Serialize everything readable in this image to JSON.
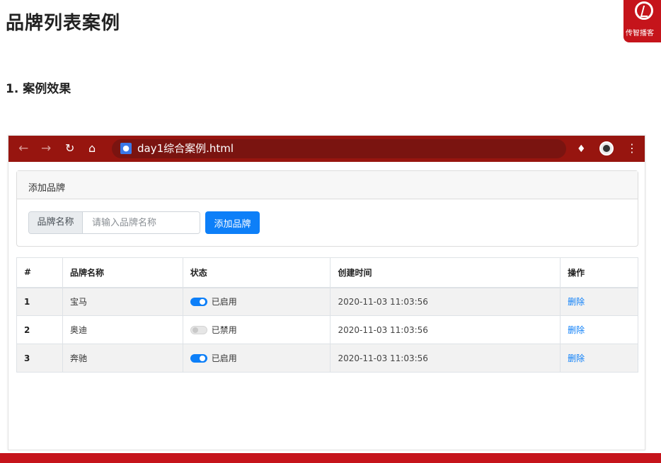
{
  "page": {
    "title": "品牌列表案例",
    "section_title": "1. 案例效果",
    "logo_text": "传智播客"
  },
  "browser": {
    "nav": {
      "back_icon": "arrow-left-icon",
      "forward_icon": "arrow-right-icon",
      "reload_icon": "reload-icon",
      "home_icon": "home-icon"
    },
    "tab_url": "day1综合案例.html",
    "toolbar_icons": [
      "extension-icon",
      "avatar",
      "more-vert-icon"
    ]
  },
  "form": {
    "card_title": "添加品牌",
    "input_label": "品牌名称",
    "input_placeholder": "请输入品牌名称",
    "input_value": "",
    "add_button": "添加品牌"
  },
  "table": {
    "headers": [
      "#",
      "品牌名称",
      "状态",
      "创建时间",
      "操作"
    ],
    "rows": [
      {
        "id": "1",
        "name": "宝马",
        "enabled": true,
        "status": "已启用",
        "time": "2020-11-03 11:03:56",
        "action": "删除"
      },
      {
        "id": "2",
        "name": "奥迪",
        "enabled": false,
        "status": "已禁用",
        "time": "2020-11-03 11:03:56",
        "action": "删除"
      },
      {
        "id": "3",
        "name": "奔驰",
        "enabled": true,
        "status": "已启用",
        "time": "2020-11-03 11:03:56",
        "action": "删除"
      }
    ]
  },
  "colors": {
    "toolbar": "#97150f",
    "brand_red": "#c5141b",
    "primary": "#0d7ff8"
  }
}
